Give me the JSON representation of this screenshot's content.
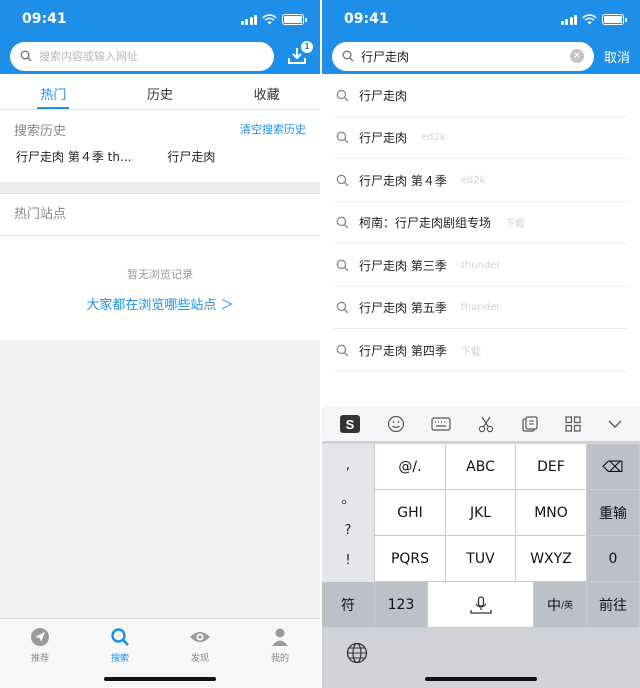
{
  "left": {
    "status": {
      "time": "09:41"
    },
    "search": {
      "placeholder": "搜索内容或输入网址",
      "download_badge": "1"
    },
    "tabs": [
      {
        "label": "热门",
        "active": true
      },
      {
        "label": "历史",
        "active": false
      },
      {
        "label": "收藏",
        "active": false
      }
    ],
    "history": {
      "title": "搜索历史",
      "clear_label": "清空搜索历史",
      "items": [
        "行尸走肉 第４季 th...",
        "行尸走肉"
      ]
    },
    "hot_sites": {
      "title": "热门站点",
      "empty_text": "暂无浏览记录",
      "link_text": "大家都在浏览哪些站点 ＞"
    },
    "tabbar": [
      {
        "label": "推荐",
        "icon": "plane-icon"
      },
      {
        "label": "搜索",
        "icon": "search-icon",
        "active": true
      },
      {
        "label": "发现",
        "icon": "eye-icon"
      },
      {
        "label": "我的",
        "icon": "user-icon"
      }
    ]
  },
  "right": {
    "status": {
      "time": "09:41"
    },
    "search": {
      "value": "行尸走肉",
      "cancel_label": "取消"
    },
    "suggestions": [
      {
        "text": "行尸走肉",
        "tag": ""
      },
      {
        "text": "行尸走肉",
        "tag": "ed2k"
      },
      {
        "text": "行尸走肉 第４季",
        "tag": "ed2k"
      },
      {
        "text": "柯南：行尸走肉剧组专场",
        "tag": "下载"
      },
      {
        "text": "行尸走肉 第三季",
        "tag": "thunder"
      },
      {
        "text": "行尸走肉 第五季",
        "tag": "thunder"
      },
      {
        "text": "行尸走肉 第四季",
        "tag": "下载"
      }
    ],
    "keyboard": {
      "toolbar": [
        "sogou-logo-icon",
        "emoji-icon",
        "keyboard-icon",
        "scissors-icon",
        "clipboard-icon",
        "grid-icon",
        "collapse-icon"
      ],
      "punct": [
        ",",
        "。",
        "?",
        "!"
      ],
      "rows": [
        [
          "@/.",
          "ABC",
          "DEF"
        ],
        [
          "GHI",
          "JKL",
          "MNO"
        ],
        [
          "PQRS",
          "TUV",
          "WXYZ"
        ]
      ],
      "delete_label": "⌫",
      "reenter_label": "重输",
      "zero_label": "0",
      "symbol_label": "符",
      "num_label": "123",
      "lang_main": "中",
      "lang_sub": "/英",
      "go_label": "前往"
    }
  },
  "colors": {
    "accent": "#1e8fe8"
  }
}
